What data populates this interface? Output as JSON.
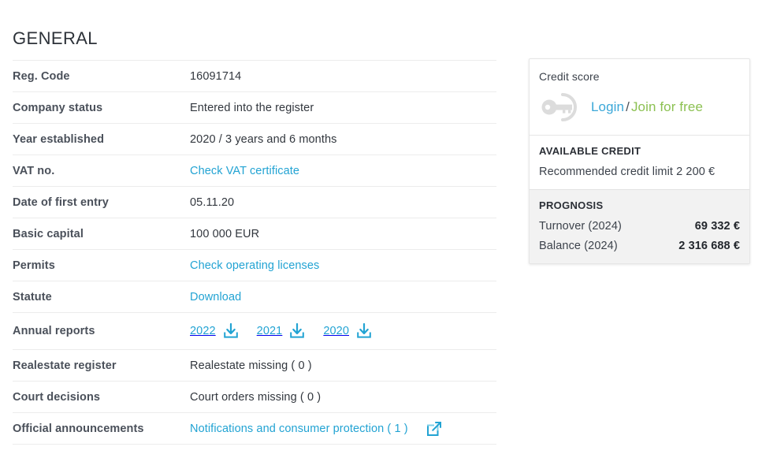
{
  "general": {
    "title": "GENERAL",
    "rows": [
      {
        "label": "Reg. Code",
        "value": "16091714",
        "type": "text"
      },
      {
        "label": "Company status",
        "value": "Entered into the register",
        "type": "text"
      },
      {
        "label": "Year established",
        "value": "2020 / 3 years and 6 months",
        "type": "text"
      },
      {
        "label": "VAT no.",
        "value": "Check VAT certificate",
        "type": "link"
      },
      {
        "label": "Date of first entry",
        "value": "05.11.20",
        "type": "text"
      },
      {
        "label": "Basic capital",
        "value": "100 000 EUR",
        "type": "text"
      },
      {
        "label": "Permits",
        "value": "Check operating licenses",
        "type": "link"
      },
      {
        "label": "Statute",
        "value": "Download",
        "type": "link"
      },
      {
        "label": "Annual reports",
        "value": "",
        "type": "reports"
      },
      {
        "label": "Realestate register",
        "value": "Realestate missing ( 0 )",
        "type": "text"
      },
      {
        "label": "Court decisions",
        "value": "Court orders missing ( 0 )",
        "type": "text"
      },
      {
        "label": "Official announcements",
        "value": "Notifications and consumer protection ( 1 )",
        "type": "announcement"
      }
    ],
    "annual_reports": [
      {
        "year": "2022",
        "icon": "download-icon"
      },
      {
        "year": "2021",
        "icon": "download-icon"
      },
      {
        "year": "2020",
        "icon": "download-icon"
      }
    ],
    "announcement_icon": "external-link-icon"
  },
  "credit_card": {
    "title": "Credit score",
    "key_icon": "key-icon",
    "login_label": "Login",
    "separator": "/",
    "join_label": "Join for free",
    "available_credit_heading": "AVAILABLE CREDIT",
    "recommended_limit": "Recommended credit limit 2 200 €",
    "prognosis_heading": "PROGNOSIS",
    "prognosis_rows": [
      {
        "label": "Turnover (2024)",
        "value": "69 332 €"
      },
      {
        "label": "Balance (2024)",
        "value": "2 316 688 €"
      }
    ]
  },
  "colors": {
    "link": "#22a3d3",
    "login": "#3aa7d8",
    "join": "#8cc152",
    "label": "#4a505a",
    "panel_grey": "#f2f2f2"
  }
}
